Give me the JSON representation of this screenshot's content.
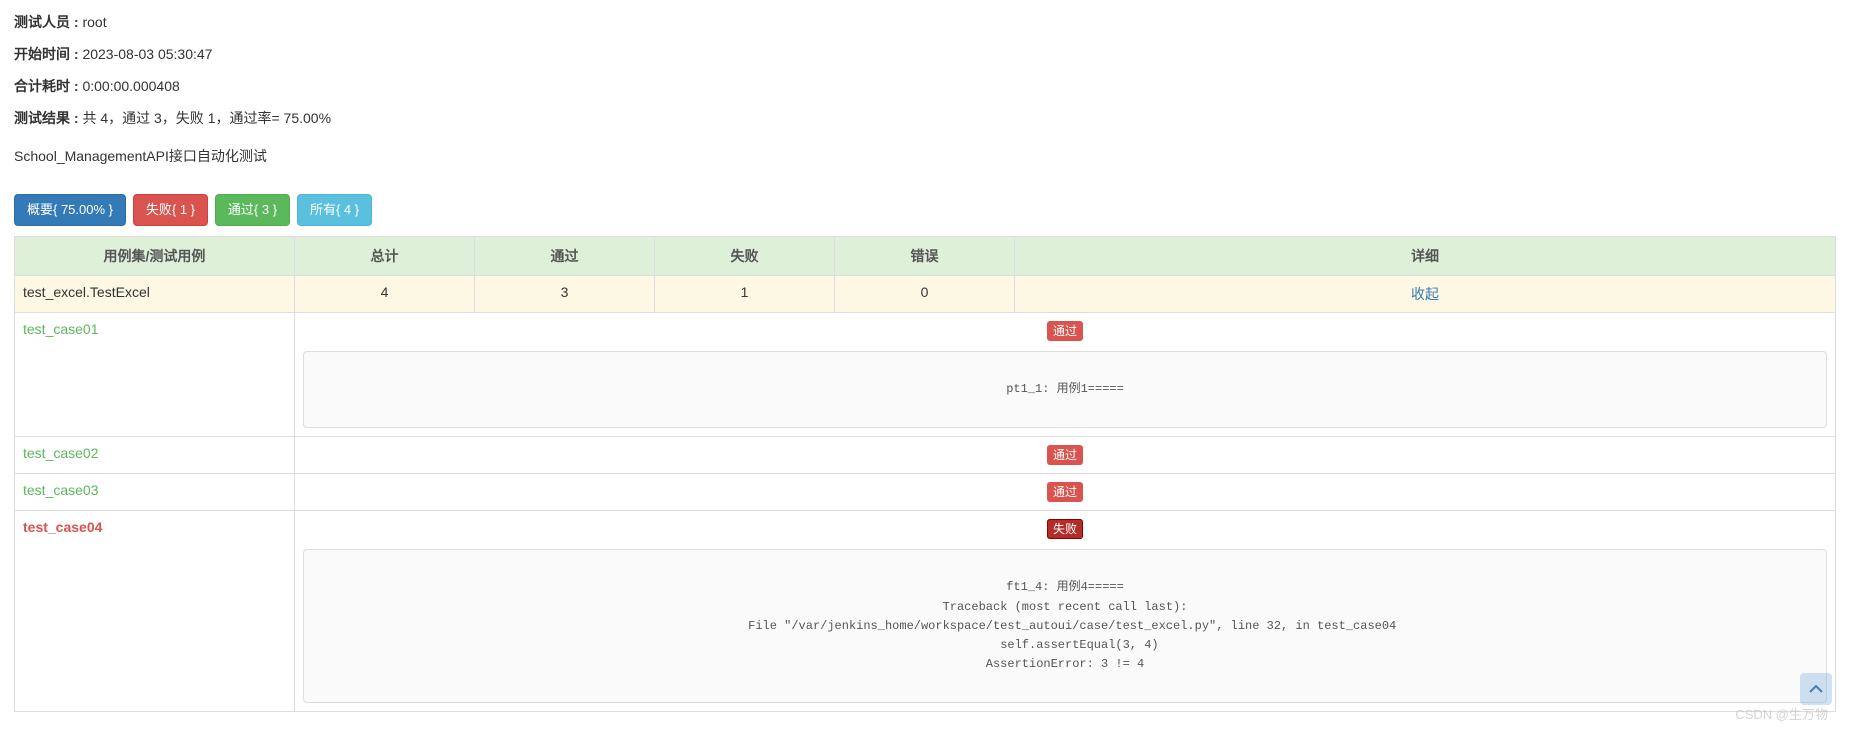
{
  "meta": {
    "tester_label": "测试人员 : ",
    "tester_value": "root",
    "start_label": "开始时间 : ",
    "start_value": "2023-08-03 05:30:47",
    "duration_label": "合计耗时 : ",
    "duration_value": "0:00:00.000408",
    "result_label": "测试结果 : ",
    "result_value": "共 4，通过 3，失败 1，通过率= 75.00%"
  },
  "description": "School_ManagementAPI接口自动化测试",
  "buttons": {
    "summary": "概要{ 75.00% }",
    "fail": "失败{ 1 }",
    "pass": "通过{ 3 }",
    "all": "所有{ 4 }"
  },
  "table": {
    "headers": {
      "suite": "用例集/测试用例",
      "total": "总计",
      "pass": "通过",
      "fail": "失败",
      "error": "错误",
      "detail": "详细"
    },
    "suite": {
      "name": "test_excel.TestExcel",
      "total": "4",
      "pass": "3",
      "fail": "1",
      "error": "0",
      "collapse": "收起"
    },
    "cases": [
      {
        "name": "test_case01",
        "status": "pass",
        "status_text": "通过",
        "log": "pt1_1: 用例1====="
      },
      {
        "name": "test_case02",
        "status": "pass",
        "status_text": "通过",
        "log": null
      },
      {
        "name": "test_case03",
        "status": "pass",
        "status_text": "通过",
        "log": null
      },
      {
        "name": "test_case04",
        "status": "fail",
        "status_text": "失败",
        "log": "ft1_4: 用例4=====\nTraceback (most recent call last):\n  File \"/var/jenkins_home/workspace/test_autoui/case/test_excel.py\", line 32, in test_case04\n    self.assertEqual(3, 4)\nAssertionError: 3 != 4"
      }
    ]
  },
  "watermark": "CSDN @生万物",
  "status_colors": {
    "pass": "#d9534f",
    "fail": "#b52b27"
  }
}
